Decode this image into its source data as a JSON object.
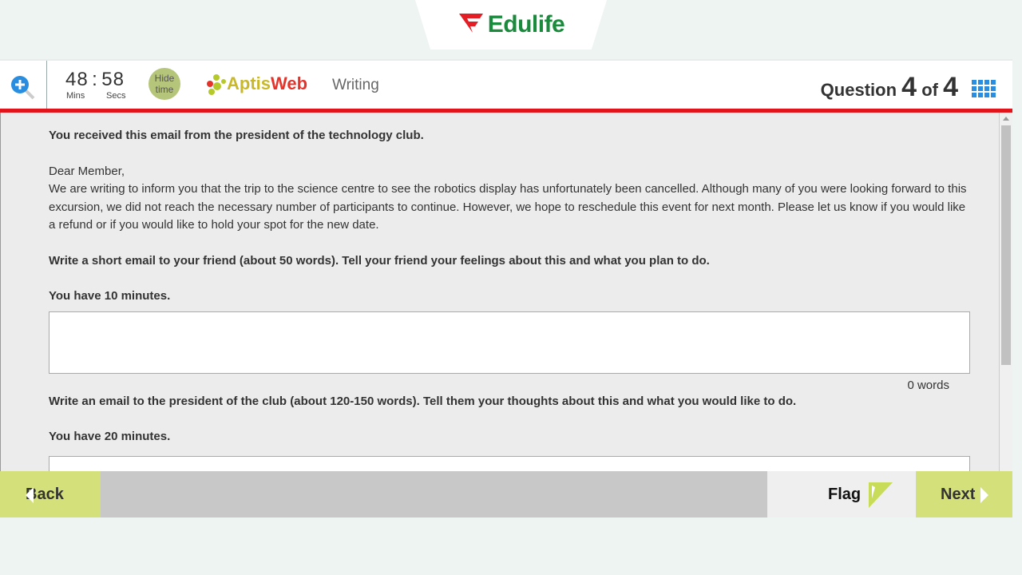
{
  "brand": {
    "name": "Edulife",
    "logo_color": "#e31e24",
    "text_color": "#1a8a3c"
  },
  "header": {
    "zoom_icon": "zoom-in-icon",
    "timer": {
      "minutes": "48",
      "separator": ":",
      "seconds": "58",
      "min_label": "Mins",
      "sec_label": "Secs"
    },
    "hide_time": {
      "line1": "Hide",
      "line2": "time"
    },
    "app_logo": {
      "part1": "Aptis",
      "part2": "Web"
    },
    "section": "Writing",
    "question": {
      "label": "Question",
      "current": "4",
      "of": "of",
      "total": "4"
    },
    "grid_icon": "question-grid-icon",
    "accent": "#e0141a"
  },
  "content": {
    "intro": "You received this email from the president of the technology club.",
    "greeting": "Dear Member,",
    "email_body": "We are writing to inform you that the trip to the science centre to see the robotics display has unfortunately been cancelled. Although many of you were looking forward to this excursion, we did not reach the necessary number of participants to continue. However, we hope to reschedule this event for next month. Please let us know if you would like a refund or if you would like to hold your spot for the new date.",
    "task1": "Write a short email to your friend (about 50 words). Tell your friend your feelings about this and what you plan to do.",
    "time1": "You have 10 minutes.",
    "answer1": "",
    "word_count1": "0 words",
    "task2": "Write an email to the president of the club (about 120-150 words). Tell them your thoughts about this and what you would like to do.",
    "time2": "You have 20 minutes.",
    "answer2": ""
  },
  "footer": {
    "back": "Back",
    "flag": "Flag",
    "next": "Next",
    "button_color": "#d4e07a"
  }
}
